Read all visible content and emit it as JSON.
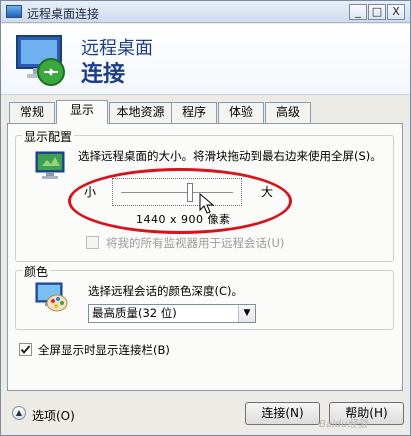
{
  "window": {
    "title": "远程桌面连接",
    "controls": {
      "minimize": "_",
      "maximize": "□",
      "close": "X"
    }
  },
  "header": {
    "title_line1": "远程桌面",
    "title_line2": "连接"
  },
  "tabs": [
    {
      "label": "常规",
      "active": false
    },
    {
      "label": "显示",
      "active": true
    },
    {
      "label": "本地资源",
      "active": false
    },
    {
      "label": "程序",
      "active": false
    },
    {
      "label": "体验",
      "active": false
    },
    {
      "label": "高级",
      "active": false
    }
  ],
  "display_config": {
    "legend": "显示配置",
    "description": "选择远程桌面的大小。将滑块拖动到最右边来使用全屏(S)。",
    "slider_small_label": "小",
    "slider_large_label": "大",
    "slider_level": 0.62,
    "resolution_text": "1440 x 900 像素",
    "multi_monitor_checkbox": {
      "label": "将我的所有监视器用于远程会话(U)",
      "checked": false,
      "enabled": false
    }
  },
  "colors": {
    "legend": "颜色",
    "description": "选择远程会话的颜色深度(C)。",
    "selected_option": "最高质量(32 位)"
  },
  "connection_bar": {
    "label": "全屏显示时显示连接栏(B)",
    "checked": true
  },
  "bottom": {
    "options_label": "选项(O)",
    "connect_button": "连接(N)",
    "help_button": "帮助(H)"
  },
  "watermark": "Baidu经验",
  "icons": {
    "title": "remote-desktop-icon",
    "header": "remote-desktop-logo-icon",
    "display": "monitor-icon",
    "colors": "color-palette-monitor-icon",
    "options": "chevron-up-icon",
    "cursor": "mouse-cursor-icon"
  },
  "accent_color": "#1f3e8a",
  "annotation_color": "#d8131c"
}
